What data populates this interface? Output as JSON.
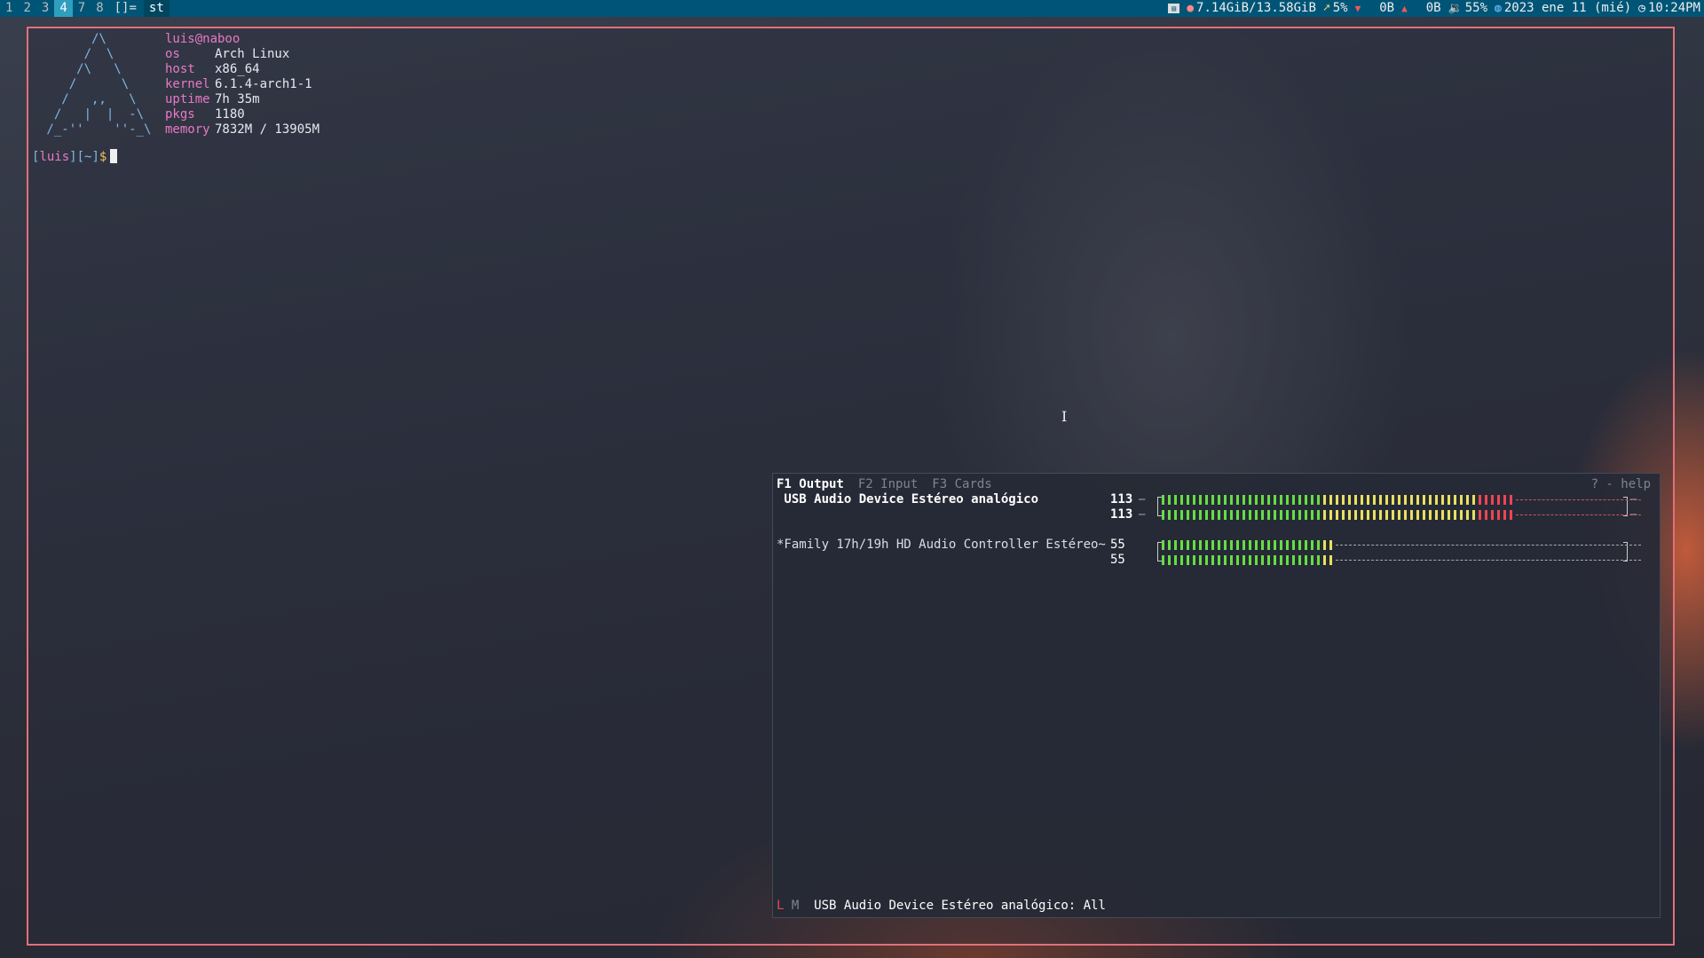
{
  "topbar": {
    "tags": [
      "1",
      "2",
      "3",
      "4",
      "7",
      "8"
    ],
    "active_tag": "4",
    "layout": "[]=",
    "window_title": "st",
    "status": {
      "memory": "7.14GiB/13.58GiB",
      "cpu": "5%",
      "net_down": "0B",
      "net_up": "0B",
      "volume": "55%",
      "date": "2023 ene 11 (mié)",
      "time": "10:24PM"
    }
  },
  "terminal": {
    "logo_lines": [
      "       /\\",
      "      /  \\",
      "     /\\   \\",
      "    /      \\",
      "   /   ,,   \\",
      "  /   |  |  -\\",
      " /_-''    ''-_\\"
    ],
    "user_host": "luis@naboo",
    "info": [
      {
        "key": "os",
        "value": "Arch Linux"
      },
      {
        "key": "host",
        "value": "x86_64"
      },
      {
        "key": "kernel",
        "value": "6.1.4-arch1-1"
      },
      {
        "key": "uptime",
        "value": "7h 35m"
      },
      {
        "key": "pkgs",
        "value": "1180"
      },
      {
        "key": "memory",
        "value": "7832M / 13905M"
      }
    ],
    "prompt": {
      "user": "luis",
      "dir": "~",
      "symbol": "$"
    }
  },
  "pulsemixer": {
    "tabs": [
      {
        "label": "F1 Output",
        "active": true
      },
      {
        "label": "F2 Input",
        "active": false
      },
      {
        "label": "F3 Cards",
        "active": false
      }
    ],
    "help": "? - help",
    "devices": [
      {
        "name": " USB Audio Device Estéreo analógico",
        "selected": true,
        "volumes": [
          "113",
          "113"
        ],
        "levels": [
          1.13,
          1.13
        ]
      },
      {
        "name": "*Family 17h/19h HD Audio Controller Estéreo~",
        "selected": false,
        "volumes": [
          "55",
          "55"
        ],
        "levels": [
          0.55,
          0.55
        ]
      }
    ],
    "status_lock": "L",
    "status_mute": "M",
    "status_text": "USB Audio Device Estéreo analógico: All"
  }
}
